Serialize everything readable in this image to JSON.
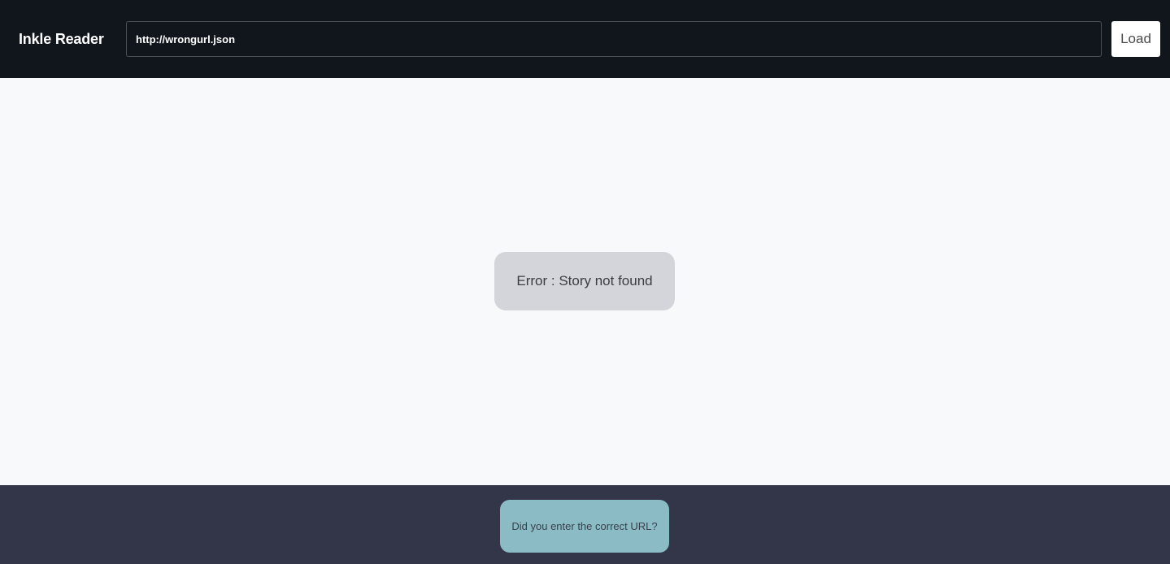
{
  "header": {
    "title": "Inkle Reader",
    "url_value": "http://wrongurl.json",
    "load_label": "Load"
  },
  "main": {
    "error_message": "Error : Story not found"
  },
  "footer": {
    "hint": "Did you enter the correct URL?"
  },
  "colors": {
    "header_bg": "#11161c",
    "main_bg": "#f8f9fa",
    "error_bg": "#d4d5da",
    "footer_bg": "#333548",
    "hint_bg": "#8bbcc6"
  }
}
